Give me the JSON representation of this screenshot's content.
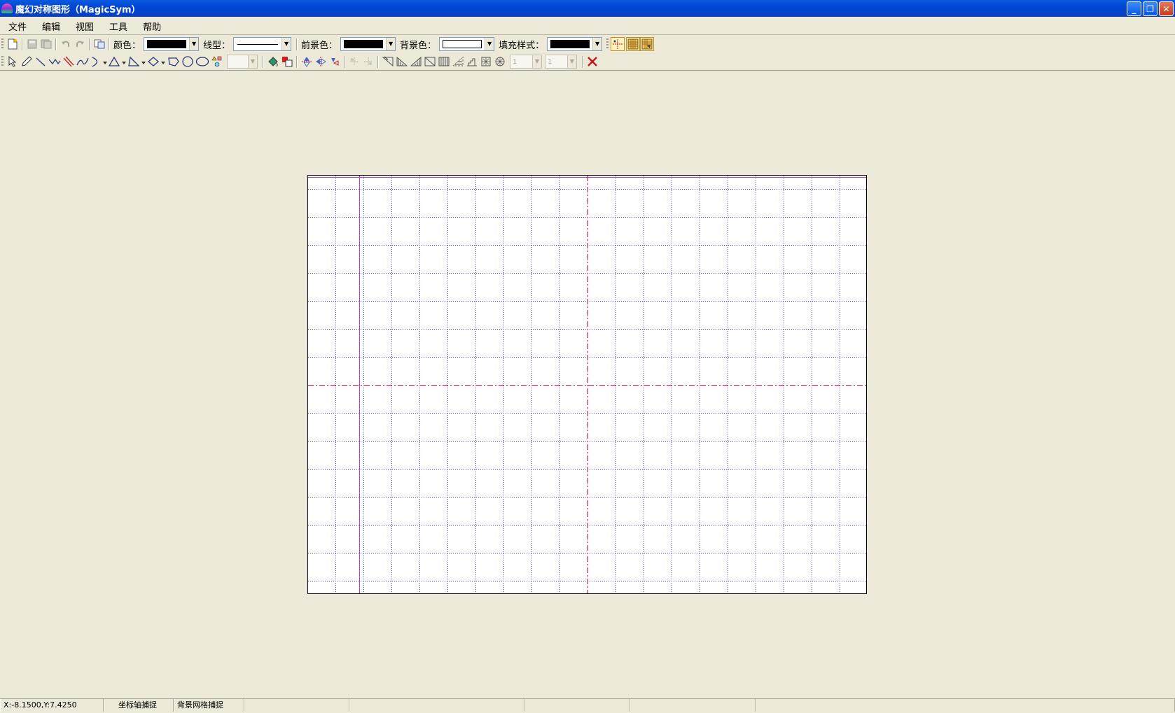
{
  "window": {
    "title": "魔幻对称图形（MagicSym）",
    "minimize_glyph": "_",
    "restore_glyph": "❐",
    "close_glyph": "✕"
  },
  "menu": [
    "文件",
    "编辑",
    "视图",
    "工具",
    "帮助"
  ],
  "toolbar1": {
    "color_label": "颜色：",
    "color_value": "#000000",
    "line_type_label": "线型：",
    "foreground_label": "前景色：",
    "foreground_value": "#000000",
    "background_label": "背景色：",
    "background_value": "#ffffff",
    "fill_style_label": "填充样式：",
    "fill_style_value": "#000000",
    "icons": [
      "new-file-icon",
      "save-icon",
      "save-as-icon",
      "undo-icon",
      "redo-icon",
      "copy-icon",
      "axis-snap-icon",
      "grid-icon",
      "grid-snap-icon"
    ]
  },
  "toolbar2": {
    "icons": [
      "select-arrow-icon",
      "pencil-icon",
      "line-icon",
      "polyline-icon",
      "parallel-lines-icon",
      "curve-icon",
      "arc-icon",
      "triangle-icon",
      "triangle-icon",
      "diamond-icon",
      "polygon-icon",
      "circle-icon",
      "ellipse-icon",
      "shapes-icon",
      "fill-bucket-icon",
      "color-replace-icon",
      "reflect-vertical-icon",
      "reflect-horizontal-icon",
      "rotate-icon",
      "close-x-icon"
    ],
    "spin1_value": "1",
    "spin2_value": "1"
  },
  "accent": {
    "axis": "#e0002a",
    "grid": "#3b3bd6",
    "mirror": "#cc33cc"
  },
  "status": {
    "coords": "X:-8.1500,Y:7.4250",
    "axis_snap": "坐标轴捕捉",
    "grid_snap": "背景网格捕捉"
  }
}
